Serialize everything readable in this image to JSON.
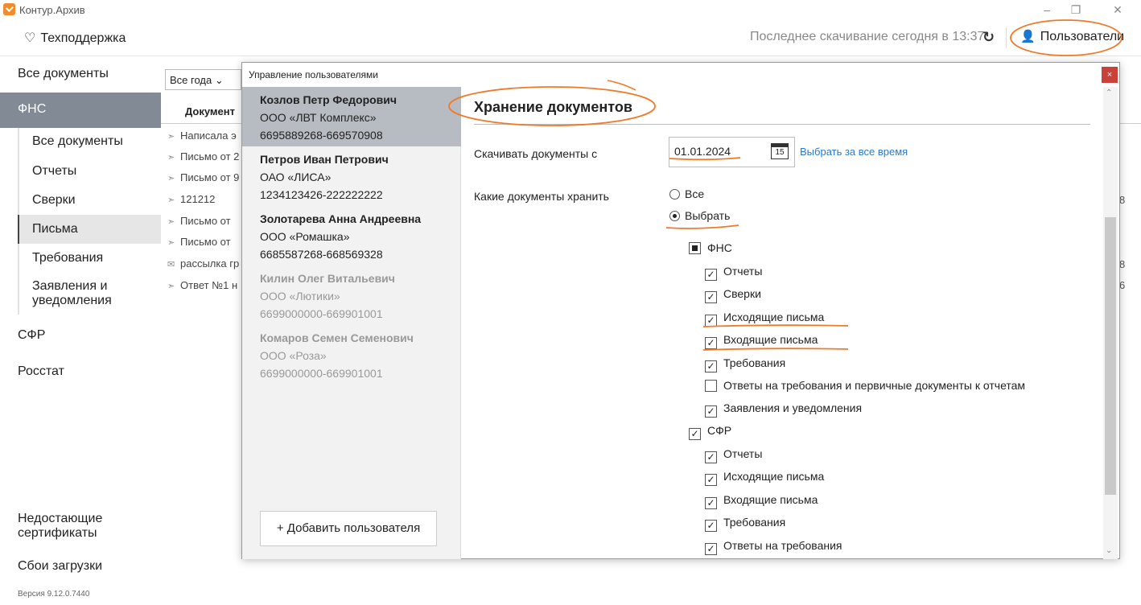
{
  "app": {
    "title": "Контур.Архив"
  },
  "window_controls": {
    "minimize": "–",
    "maximize": "❐",
    "close": "✕"
  },
  "header": {
    "support": "Техподдержка",
    "last_download": "Последнее скачивание сегодня в 13:37",
    "users_button": "Пользователи"
  },
  "sidebar": {
    "all_docs": "Все документы",
    "fns": "ФНС",
    "fns_items": [
      "Все документы",
      "Отчеты",
      "Сверки",
      "Письма",
      "Требования",
      "Заявления и уведомления"
    ],
    "sfr": "СФР",
    "rosstat": "Росстат",
    "missing_certs": "Недостающие сертификаты",
    "load_errors": "Сбои загрузки",
    "version": "Версия 9.12.0.7440"
  },
  "main": {
    "year_filter": "Все года",
    "column_document": "Документ",
    "rows": [
      "Написала э",
      "Письмо от 2",
      "Письмо от 9",
      "121212",
      "Письмо от",
      "Письмо от",
      "рассылка гр",
      "Ответ №1 н"
    ],
    "right_numbers": [
      "8",
      "8",
      "6"
    ]
  },
  "modal": {
    "title": "Управление пользователями",
    "close": "×",
    "users": [
      {
        "name": "Козлов Петр Федорович",
        "org": "ООО «ЛВТ Комплекс»",
        "inn": "6695889268-669570908"
      },
      {
        "name": "Петров Иван Петрович",
        "org": "ОАО «ЛИСА»",
        "inn": "1234123426-222222222"
      },
      {
        "name": "Золотарева Анна Андреевна",
        "org": "ООО «Ромашка»",
        "inn": "6685587268-668569328"
      },
      {
        "name": "Килин Олег Витальевич",
        "org": "ООО «Лютики»",
        "inn": "6699000000-669901001"
      },
      {
        "name": "Комаров Семен Семенович",
        "org": "ООО «Роза»",
        "inn": "6699000000-669901001"
      }
    ],
    "add_user": "+ Добавить пользователя",
    "section_title": "Хранение документов",
    "download_from_label": "Скачивать документы с",
    "download_from_value": "01.01.2024",
    "calendar_day": "15",
    "all_time_link": "Выбрать за все время",
    "which_docs_label": "Какие документы хранить",
    "radio_all": "Все",
    "radio_select": "Выбрать",
    "fns_group": "ФНС",
    "fns_options": [
      "Отчеты",
      "Сверки",
      "Исходящие письма",
      "Входящие письма",
      "Требования",
      "Ответы на требования и первичные документы к отчетам",
      "Заявления и уведомления"
    ],
    "fns_checked": [
      true,
      true,
      true,
      true,
      true,
      false,
      true
    ],
    "sfr_group": "СФР",
    "sfr_options": [
      "Отчеты",
      "Исходящие письма",
      "Входящие письма",
      "Требования",
      "Ответы на требования"
    ],
    "sfr_checked": [
      true,
      true,
      true,
      true,
      true
    ]
  },
  "colors": {
    "accent_orange": "#f07a2a",
    "selected_nav": "#828a95",
    "link": "#2a7ac8",
    "close_btn": "#c8423a"
  }
}
